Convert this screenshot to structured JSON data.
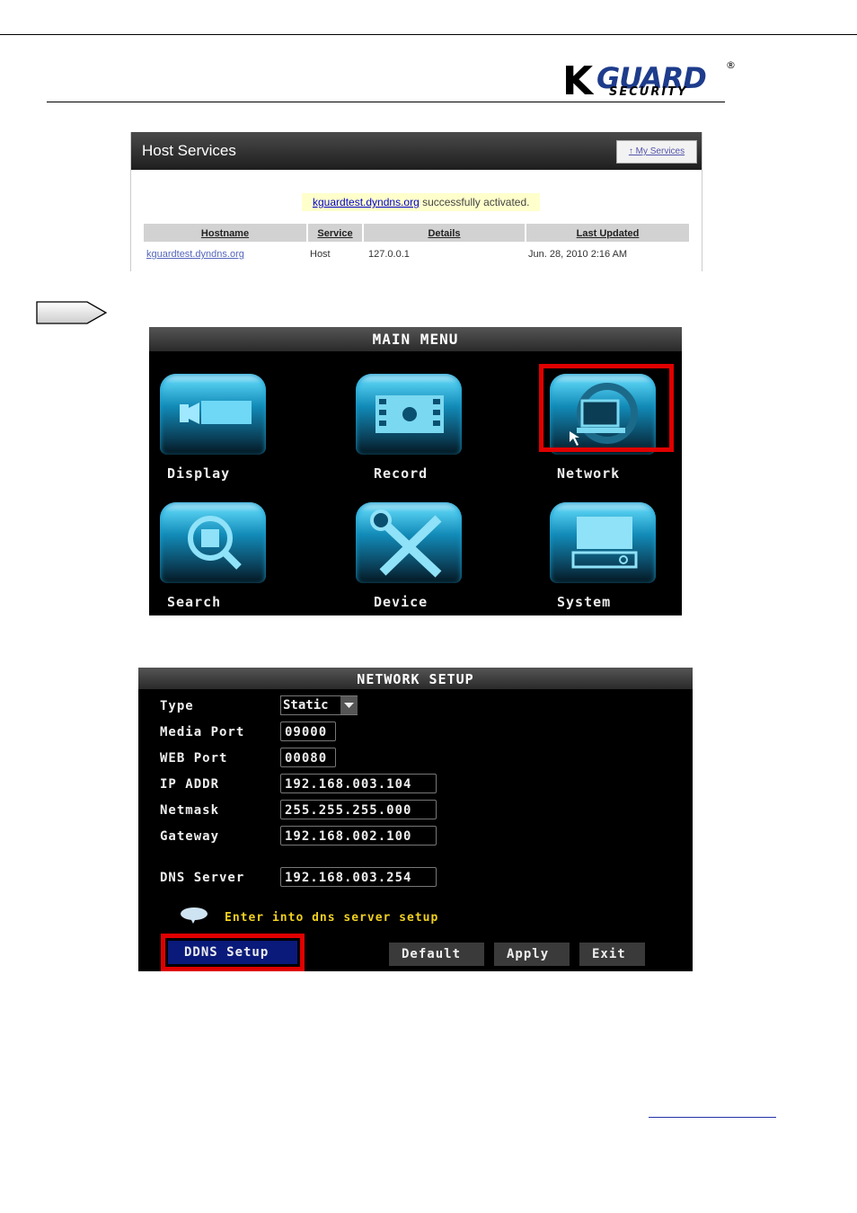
{
  "logo": {
    "k": "K",
    "guard": "GUARD",
    "security": "SECURITY",
    "reg": "®"
  },
  "host_services": {
    "title": "Host Services",
    "my_services": "↑ My Services",
    "message_link": "kguardtest.dyndns.org",
    "message_text": " successfully activated.",
    "columns": [
      "Hostname",
      "Service",
      "Details",
      "Last Updated"
    ],
    "row": {
      "hostname": "kguardtest.dyndns.org",
      "service": "Host",
      "details": "127.0.0.1",
      "updated": "Jun. 28, 2010 2:16 AM"
    }
  },
  "main_menu": {
    "title": "MAIN MENU",
    "items": [
      "Display",
      "Record",
      "Network",
      "Search",
      "Device",
      "System"
    ],
    "selected": "Network"
  },
  "network_setup": {
    "title": "NETWORK SETUP",
    "labels": {
      "type": "Type",
      "media_port": "Media Port",
      "web_port": "WEB Port",
      "ip": "IP ADDR",
      "netmask": "Netmask",
      "gateway": "Gateway",
      "dns": "DNS Server"
    },
    "values": {
      "type": "Static",
      "media_port": "09000",
      "web_port": "00080",
      "ip": "192.168.003.104",
      "netmask": "255.255.255.000",
      "gateway": "192.168.002.100",
      "dns": "192.168.003.254"
    },
    "hint": "Enter into dns server setup",
    "buttons": {
      "ddns": "DDNS Setup",
      "default": "Default",
      "apply": "Apply",
      "exit": "Exit"
    }
  },
  "colors": {
    "highlight": "#e00000",
    "hint": "#f0d020",
    "tile": "#1aa0d0"
  }
}
